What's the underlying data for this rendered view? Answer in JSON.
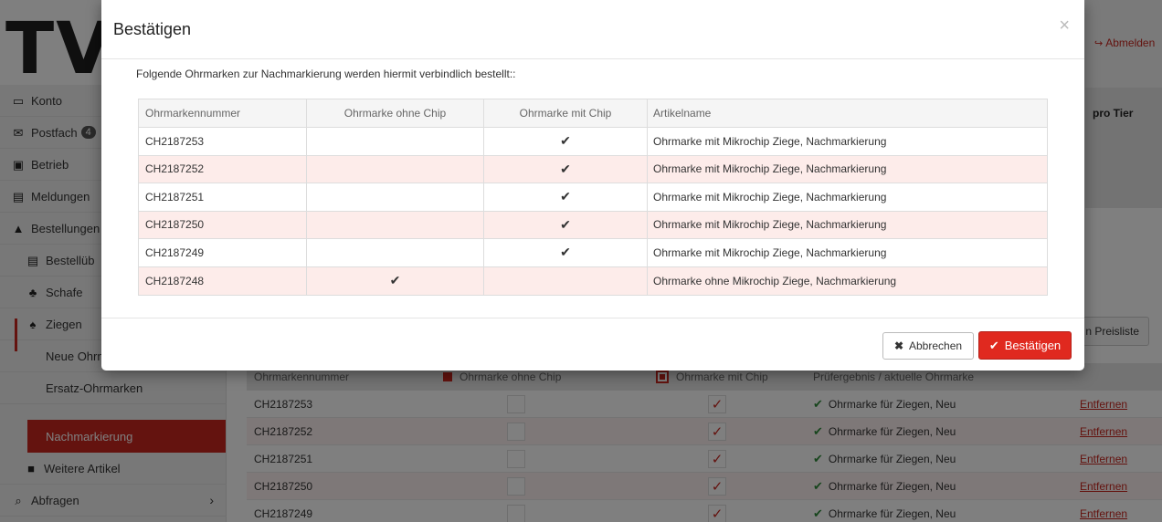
{
  "app": {
    "logo": "TV",
    "logout_label": "Abmelden"
  },
  "sidebar": {
    "items": [
      {
        "label": "Konto",
        "icon": "card-icon"
      },
      {
        "label": "Postfach",
        "icon": "mail-icon",
        "badge": "4"
      },
      {
        "label": "Betrieb",
        "icon": "factory-icon"
      },
      {
        "label": "Meldungen",
        "icon": "clipboard-icon"
      },
      {
        "label": "Bestellungen",
        "icon": "shopping-bag-icon"
      },
      {
        "label": "Bestellüb",
        "icon": "list-icon"
      },
      {
        "label": "Schafe",
        "icon": "sheep-icon"
      },
      {
        "label": "Ziegen",
        "icon": "goat-icon"
      },
      {
        "label": "Neue Ohrmarken"
      },
      {
        "label": "Ersatz-Ohrmarken"
      },
      {
        "label": "Nachmarkierung"
      },
      {
        "label": "Weitere Artikel",
        "icon": "boxes-icon"
      },
      {
        "label": "Abfragen",
        "icon": "search-icon"
      }
    ]
  },
  "background": {
    "panel_text": "pro Tier",
    "preisliste_label": "n Preisliste",
    "table": {
      "headers": [
        "Ohrmarkennummer",
        "Ohrmarke ohne Chip",
        "Ohrmarke mit Chip",
        "Prüfergebnis / aktuelle Ohrmarke"
      ],
      "rows": [
        {
          "number": "CH2187253",
          "result": "Ohrmarke für Ziegen, Neu",
          "action": "Entfernen"
        },
        {
          "number": "CH2187252",
          "result": "Ohrmarke für Ziegen, Neu",
          "action": "Entfernen"
        },
        {
          "number": "CH2187251",
          "result": "Ohrmarke für Ziegen, Neu",
          "action": "Entfernen"
        },
        {
          "number": "CH2187250",
          "result": "Ohrmarke für Ziegen, Neu",
          "action": "Entfernen"
        },
        {
          "number": "CH2187249",
          "result": "Ohrmarke für Ziegen, Neu",
          "action": "Entfernen"
        }
      ]
    }
  },
  "modal": {
    "title": "Bestätigen",
    "close_symbol": "×",
    "intro": "Folgende Ohrmarken zur Nachmarkierung werden hiermit verbindlich bestellt::",
    "table": {
      "headers": [
        "Ohrmarkennummer",
        "Ohrmarke ohne Chip",
        "Ohrmarke mit Chip",
        "Artikelname"
      ],
      "rows": [
        {
          "number": "CH2187253",
          "without_chip": false,
          "with_chip": true,
          "article": "Ohrmarke mit Mikrochip Ziege, Nachmarkierung"
        },
        {
          "number": "CH2187252",
          "without_chip": false,
          "with_chip": true,
          "article": "Ohrmarke mit Mikrochip Ziege, Nachmarkierung"
        },
        {
          "number": "CH2187251",
          "without_chip": false,
          "with_chip": true,
          "article": "Ohrmarke mit Mikrochip Ziege, Nachmarkierung"
        },
        {
          "number": "CH2187250",
          "without_chip": false,
          "with_chip": true,
          "article": "Ohrmarke mit Mikrochip Ziege, Nachmarkierung"
        },
        {
          "number": "CH2187249",
          "without_chip": false,
          "with_chip": true,
          "article": "Ohrmarke mit Mikrochip Ziege, Nachmarkierung"
        },
        {
          "number": "CH2187248",
          "without_chip": true,
          "with_chip": false,
          "article": "Ohrmarke ohne Mikrochip Ziege, Nachmarkierung"
        }
      ]
    },
    "cancel_label": "Abbrechen",
    "confirm_label": "Bestätigen"
  },
  "colors": {
    "accent": "#c8261f",
    "confirm_button": "#e0291f",
    "row_alt": "#fdecea",
    "ok_green": "#2e8b3a"
  }
}
